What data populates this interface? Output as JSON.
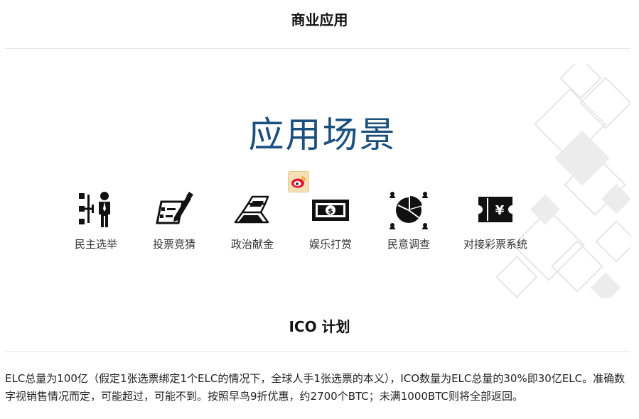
{
  "sections": {
    "business_title": "商业应用",
    "ico_title": "ICO 计划"
  },
  "banner": {
    "heading": "应用场景",
    "heading_color": "#1a4f7e",
    "scenarios": [
      {
        "label": "民主选举",
        "icon": "election-icon"
      },
      {
        "label": "投票竞猜",
        "icon": "vote-icon"
      },
      {
        "label": "政治献金",
        "icon": "gold-icon"
      },
      {
        "label": "娱乐打赏",
        "icon": "money-icon"
      },
      {
        "label": "民意调查",
        "icon": "survey-icon"
      },
      {
        "label": "对接彩票系统",
        "icon": "lottery-ticket-icon"
      }
    ],
    "badge_icon": "weibo-icon"
  },
  "ico": {
    "paragraph": "ELC总量为100亿（假定1张选票绑定1个ELC的情况下，全球人手1张选票的本义），ICO数量为ELC总量的30%即30亿ELC。准确数字视销售情况而定，可能超过，可能不到。按照早鸟9折优惠，约2700个BTC；未满1000BTC则将全部返回。"
  }
}
